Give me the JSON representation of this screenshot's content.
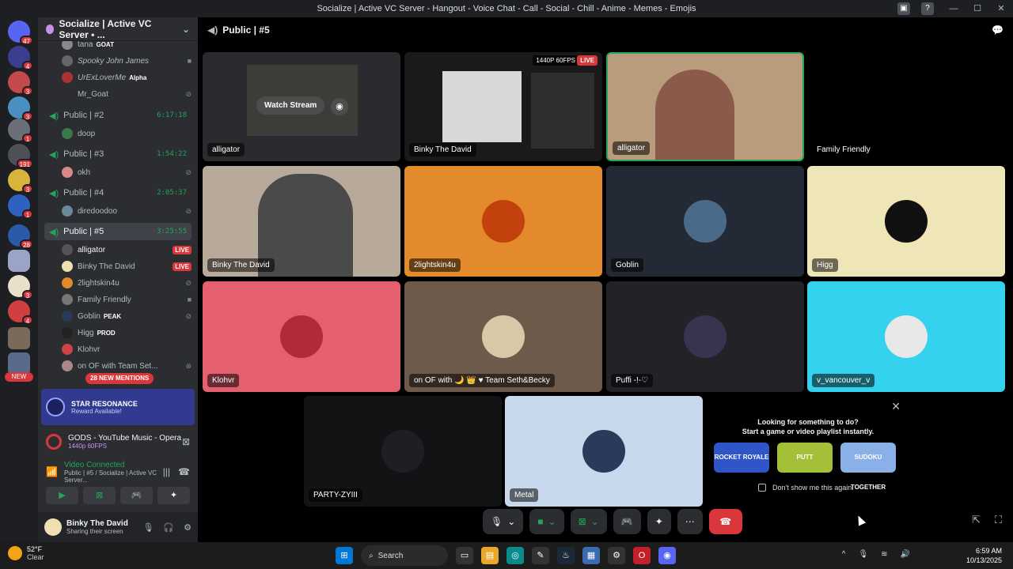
{
  "window": {
    "title": "Socialize | Active VC Server - Hangout - Voice Chat - Call - Social - Chill - Anime - Memes - Emojis",
    "controls": [
      "—",
      "☐",
      "✕"
    ]
  },
  "server_rail": {
    "servers": [
      {
        "badge": "47",
        "color": "#5865f2"
      },
      {
        "badge": "4",
        "color": "#3a3f8f"
      },
      {
        "badge": "3",
        "color": "#c24a4a"
      },
      {
        "badge": "3",
        "color": "#4a8fc2"
      },
      {
        "badge": "1",
        "color": "#6d6f78"
      },
      {
        "badge": "191",
        "color": "#4e5058"
      },
      {
        "badge": "3",
        "color": "#d9b43a"
      },
      {
        "badge": "1",
        "color": "#3060c0"
      },
      {
        "badge": "28",
        "color": "#2a5aa8"
      },
      {
        "badge": "",
        "color": "#9aa4c8"
      },
      {
        "badge": "3",
        "color": "#e8e0c8"
      },
      {
        "badge": "4",
        "color": "#d04040"
      },
      {
        "badge": "",
        "color": "#7a6a5a"
      },
      {
        "badge": "",
        "color": "#5a6a8a"
      }
    ],
    "new_label": "NEW"
  },
  "sidebar": {
    "server_name": "Socialize | Active VC Server • ...",
    "top_members": [
      {
        "name": "tana",
        "tag": "GOAT"
      },
      {
        "name": "Spooky John James",
        "tag": ""
      },
      {
        "name": "UrExLoverMe",
        "tag": "Alpha"
      },
      {
        "name": "Mr_Goat",
        "tag": ""
      }
    ],
    "channels": [
      {
        "name": "Public | #2",
        "time": "6:17:18",
        "members": [
          "doop"
        ]
      },
      {
        "name": "Public | #3",
        "time": "1:54:22",
        "members": [
          "okh"
        ]
      },
      {
        "name": "Public | #4",
        "time": "2:05:37",
        "members": [
          "diredoodoo"
        ]
      },
      {
        "name": "Public | #5",
        "time": "3:25:55",
        "members": []
      }
    ],
    "active_members": [
      {
        "name": "alligator",
        "tag": "",
        "live": "LIVE"
      },
      {
        "name": "Binky The David",
        "tag": "",
        "live": "LIVE"
      },
      {
        "name": "2lightskin4u",
        "tag": "",
        "live": ""
      },
      {
        "name": "Family Friendly",
        "tag": "",
        "live": ""
      },
      {
        "name": "Goblin",
        "tag": "PEAK",
        "live": ""
      },
      {
        "name": "Higg",
        "tag": "PROD",
        "live": ""
      },
      {
        "name": "Klohvr",
        "tag": "",
        "live": ""
      },
      {
        "name": "on OF with Team Set...",
        "tag": "",
        "live": ""
      }
    ],
    "mentions": "28 NEW MENTIONS",
    "promo": {
      "title": "STAR RESONANCE",
      "subtitle": "Reward Available!"
    },
    "activity": {
      "title": "GODS - YouTube Music - Opera",
      "subtitle": "1440p 60FPS"
    },
    "voice": {
      "status": "Video Connected",
      "location": "Public | #5 / Socialize | Active VC Server..."
    },
    "voice_buttons": [
      "▶",
      "⊠",
      "🎮",
      "✦"
    ],
    "user": {
      "name": "Binky The David",
      "status": "Sharing their screen"
    }
  },
  "main": {
    "channel_title": "Public | #5",
    "tiles": [
      {
        "name": "alligator",
        "watch": "Watch Stream"
      },
      {
        "name": "Binky The David",
        "quality": "1440P 60FPS",
        "live": "LIVE"
      },
      {
        "name": "alligator"
      },
      {
        "name": "Family Friendly"
      },
      {
        "name": "Binky The David"
      },
      {
        "name": "2lightskin4u"
      },
      {
        "name": "Goblin"
      },
      {
        "name": "Higg"
      },
      {
        "name": "Klohvr"
      },
      {
        "name": "on OF with 🌙 👑 ♥ Team Seth&Becky"
      },
      {
        "name": "Puffi -!-♡"
      },
      {
        "name": "v_vancouver_v"
      },
      {
        "name": "PARTY-ZYIII"
      },
      {
        "name": "Metal"
      }
    ],
    "suggest": {
      "line1": "Looking for something to do?",
      "line2": "Start a game or video playlist instantly.",
      "games": [
        "ROCKET ROYALE",
        "PUTT",
        "SUDOKU TOGETHER"
      ],
      "dont_show": "Don't show me this again."
    }
  },
  "taskbar": {
    "weather_temp": "52°F",
    "weather_desc": "Clear",
    "search": "Search",
    "time": "6:59 AM",
    "date": "10/13/2025"
  }
}
